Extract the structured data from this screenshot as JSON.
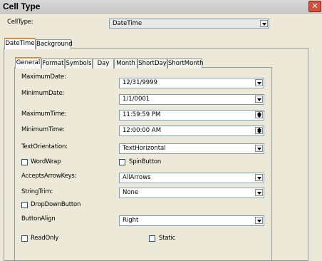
{
  "window": {
    "title": "Cell Type",
    "close_glyph": "✕"
  },
  "celltype": {
    "label": "CellType:",
    "value": "DateTime"
  },
  "outer_tabs": [
    {
      "label": "DateTime",
      "selected": true
    },
    {
      "label": "Background",
      "selected": false
    }
  ],
  "inner_tabs": [
    {
      "label": "General",
      "selected": true
    },
    {
      "label": "Format",
      "selected": false
    },
    {
      "label": "Symbols",
      "selected": false
    },
    {
      "label": "Day",
      "selected": false
    },
    {
      "label": "Month",
      "selected": false
    },
    {
      "label": "ShortDay",
      "selected": false
    },
    {
      "label": "ShortMonth",
      "selected": false
    }
  ],
  "fields": {
    "maximum_date": {
      "label": "MaximumDate:",
      "value": "12/31/9999"
    },
    "minimum_date": {
      "label": "MinimumDate:",
      "value": "1/1/0001"
    },
    "maximum_time": {
      "label": "MaximumTime:",
      "value": "11:59:59 PM"
    },
    "minimum_time": {
      "label": "MinimumTime:",
      "value": "12:00:00 AM"
    },
    "text_orientation": {
      "label": "TextOrientation:",
      "value": "TextHorizontal"
    },
    "word_wrap": {
      "label": "WordWrap",
      "checked": false
    },
    "spin_button": {
      "label": "SpinButton",
      "checked": false
    },
    "accepts_arrow_keys": {
      "label": "AcceptsArrowKeys:",
      "value": "AllArrows"
    },
    "string_trim": {
      "label": "StringTrim:",
      "value": "None"
    },
    "drop_down_button": {
      "label": "DropDownButton",
      "checked": false
    },
    "button_align": {
      "label": "ButtonAlign",
      "value": "Right"
    },
    "read_only": {
      "label": "ReadOnly",
      "checked": false
    },
    "static": {
      "label": "Static",
      "checked": false
    }
  },
  "icons": {
    "close": "close-icon",
    "dropdown": "chevron-down-icon",
    "spin": "spin-updown-icon"
  }
}
